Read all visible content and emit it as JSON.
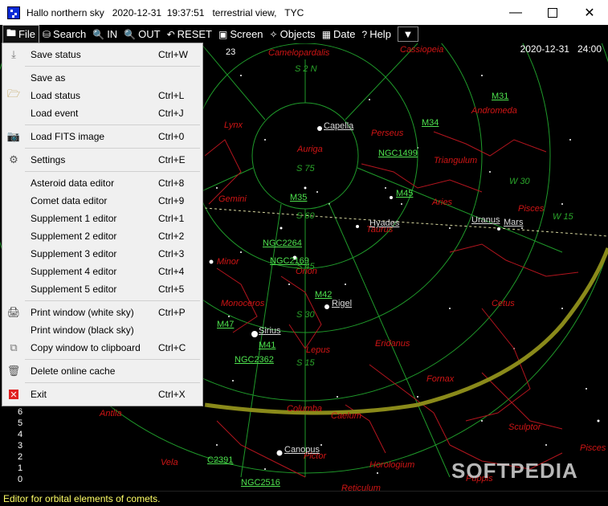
{
  "window": {
    "title": "Hallo northern sky   2020-12-31  19:37:51   terrestrial view,   TYC",
    "min_icon": "minimize-icon",
    "max_icon": "maximize-icon",
    "close_icon": "close-icon"
  },
  "toolbar": {
    "file": "File",
    "search": "Search",
    "zoom_in": "IN",
    "zoom_out": "OUT",
    "reset": "RESET",
    "screen": "Screen",
    "objects": "Objects",
    "date": "Date",
    "help": "Help",
    "date_readout": "2020-12-31",
    "time_readout": "24:00"
  },
  "menu": {
    "items": [
      {
        "label": "Save status",
        "shortcut": "Ctrl+W",
        "icon": "download-icon"
      },
      {
        "label": "Save as",
        "shortcut": "",
        "icon": ""
      },
      {
        "label": "Load status",
        "shortcut": "Ctrl+L",
        "icon": "folder-open-icon"
      },
      {
        "label": "Load event",
        "shortcut": "Ctrl+J",
        "icon": ""
      },
      {
        "label": "Load FITS image",
        "shortcut": "Ctrl+0",
        "icon": "camera-icon"
      },
      {
        "label": "Settings",
        "shortcut": "Ctrl+E",
        "icon": "settings-icon"
      },
      {
        "label": "Asteroid data editor",
        "shortcut": "Ctrl+8",
        "icon": ""
      },
      {
        "label": "Comet data editor",
        "shortcut": "Ctrl+9",
        "icon": ""
      },
      {
        "label": "Supplement 1 editor",
        "shortcut": "Ctrl+1",
        "icon": ""
      },
      {
        "label": "Supplement 2 editor",
        "shortcut": "Ctrl+2",
        "icon": ""
      },
      {
        "label": "Supplement 3 editor",
        "shortcut": "Ctrl+3",
        "icon": ""
      },
      {
        "label": "Supplement 4 editor",
        "shortcut": "Ctrl+4",
        "icon": ""
      },
      {
        "label": "Supplement 5 editor",
        "shortcut": "Ctrl+5",
        "icon": ""
      },
      {
        "label": "Print window (white sky)",
        "shortcut": "Ctrl+P",
        "icon": "printer-icon"
      },
      {
        "label": "Print window (black sky)",
        "shortcut": "",
        "icon": ""
      },
      {
        "label": "Copy window to clipboard",
        "shortcut": "Ctrl+C",
        "icon": "copy-icon"
      },
      {
        "label": "Delete online cache",
        "shortcut": "",
        "icon": "trash-icon"
      },
      {
        "label": "Exit",
        "shortcut": "Ctrl+X",
        "icon": "exit-icon"
      }
    ]
  },
  "sky": {
    "constellations": [
      "Camelopardalis",
      "Cassiopeia",
      "Lynx",
      "Perseus",
      "Andromeda",
      "Auriga",
      "Triangulum",
      "Gemini",
      "Aries",
      "Pisces",
      "Taurus",
      "Minor",
      "Orion",
      "Monoceros",
      "Cetus",
      "Eridanus",
      "Lepus",
      "Fornax",
      "Columba",
      "Caelum",
      "Antlia",
      "Sculptor",
      "Vela",
      "Pictor",
      "Horologium",
      "Puppis",
      "Pisces",
      "Reticulum"
    ],
    "stars": [
      "Capella",
      "Hyades",
      "Rigel",
      "Sirius",
      "Canopus"
    ],
    "planets": [
      "Uranus",
      "Mars"
    ],
    "objects": [
      "M31",
      "M34",
      "NGC1499",
      "M45",
      "M35",
      "NGC2264",
      "NGC2169",
      "M42",
      "M47",
      "M41",
      "NGC2362",
      "C2391",
      "NGC2516"
    ],
    "grid_labels": [
      "S 75",
      "S 60",
      "S 45",
      "S 30",
      "S 15",
      "W 30",
      "W 15",
      "S 2 N",
      "23"
    ],
    "mag_scale": [
      "6",
      "5",
      "4",
      "3",
      "2",
      "1",
      "0"
    ],
    "watermark": "SOFTPEDIA"
  },
  "status": {
    "text": "Editor for orbital elements of comets."
  },
  "colors": {
    "grid": "#1f9a2a",
    "constellation_line": "#b3151e",
    "constellation_name": "#d01515",
    "object_label": "#4ee24e",
    "horizon": "#8a8a1a",
    "status_text": "#ffff66"
  }
}
